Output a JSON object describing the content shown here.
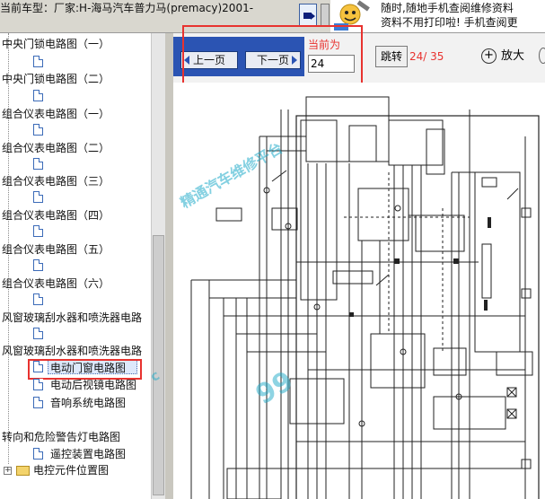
{
  "window": {
    "title": "当前车型：厂家:H-海马汽车普力马(premacy)2001-"
  },
  "ad_banner": {
    "line1": "随时,随地手机查阅维修资料",
    "line2": "资料不用打印啦! 手机查阅更"
  },
  "tree": {
    "items": [
      {
        "label": "中央门锁电路图（一）"
      },
      {
        "label": "中央门锁电路图（二）"
      },
      {
        "label": "组合仪表电路图（一）"
      },
      {
        "label": "组合仪表电路图（二）"
      },
      {
        "label": "组合仪表电路图（三）"
      },
      {
        "label": "组合仪表电路图（四）"
      },
      {
        "label": "组合仪表电路图（五）"
      },
      {
        "label": "组合仪表电路图（六）"
      },
      {
        "label": "风窗玻璃刮水器和喷洗器电路"
      },
      {
        "label": "风窗玻璃刮水器和喷洗器电路"
      },
      {
        "label": "电动门窗电路图"
      },
      {
        "label": "电动后视镜电路图"
      },
      {
        "label": "音响系统电路图"
      },
      {
        "label": "转向和危险警告灯电路图"
      },
      {
        "label": "遥控装置电路图"
      },
      {
        "label": "电控元件位置图"
      }
    ],
    "selected_index": 10
  },
  "toolbar": {
    "prev_label": "上一页",
    "next_label": "下一页",
    "current_label": "当前为",
    "page_value": "24",
    "goto_label": "跳转",
    "current_page": "24",
    "total_pages": "35",
    "page_separator": "/",
    "zoom_label": "放大"
  },
  "diagram": {
    "watermark_top": "精通汽车维修平台",
    "watermark_small": "c",
    "watermark_big": "99"
  },
  "colors": {
    "accent_red": "#e8322f",
    "toolbar_blue": "#2b54b3",
    "watermark": "#1eaac8"
  }
}
